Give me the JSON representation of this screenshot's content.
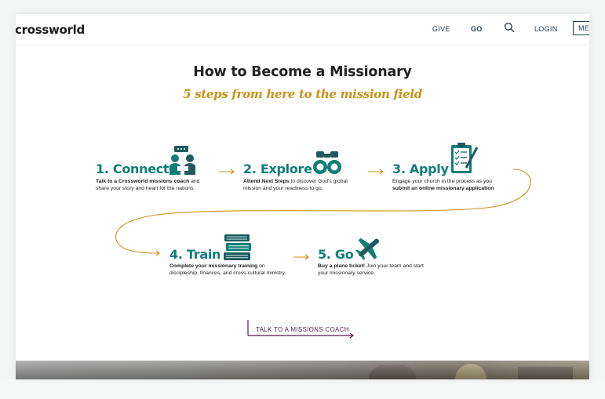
{
  "header": {
    "logo": "crossworld",
    "nav": {
      "give": "GIVE",
      "go": "GO",
      "login": "LOGIN",
      "menu": "ME"
    }
  },
  "hero": {
    "title": "How to Become a Missionary",
    "subtitle": "5 steps from here to the mission field"
  },
  "steps": [
    {
      "title": "1. Connect",
      "desc_bold": "Talk to a Crossworld missions coach",
      "desc_rest": " and share your story and heart for the nations.",
      "icon": "people-chat-icon"
    },
    {
      "title": "2. Explore",
      "desc_bold": "Attend Next Steps",
      "desc_rest": " to discover God's global mission and your readiness to go.",
      "icon": "binoculars-icon"
    },
    {
      "title": "3. Apply",
      "desc_pre": "Engage your church in the process as you ",
      "desc_bold": "submit an online missionary application",
      "icon": "clipboard-icon"
    },
    {
      "title": "4. Train",
      "desc_bold": "Complete your missionary training",
      "desc_rest": " on discipleship, finances, and cross-cultural ministry.",
      "icon": "books-icon"
    },
    {
      "title": "5. Go",
      "desc_bold": "Buy a plane ticket!",
      "desc_rest": " Join your team and start your missionary service.",
      "icon": "airplane-icon"
    }
  ],
  "cta": {
    "label": "TALK TO A MISSIONS COACH"
  },
  "colors": {
    "teal": "#117e78",
    "gold": "#c9911a",
    "plum": "#5a1a4a",
    "navy": "#1d3a4a"
  }
}
